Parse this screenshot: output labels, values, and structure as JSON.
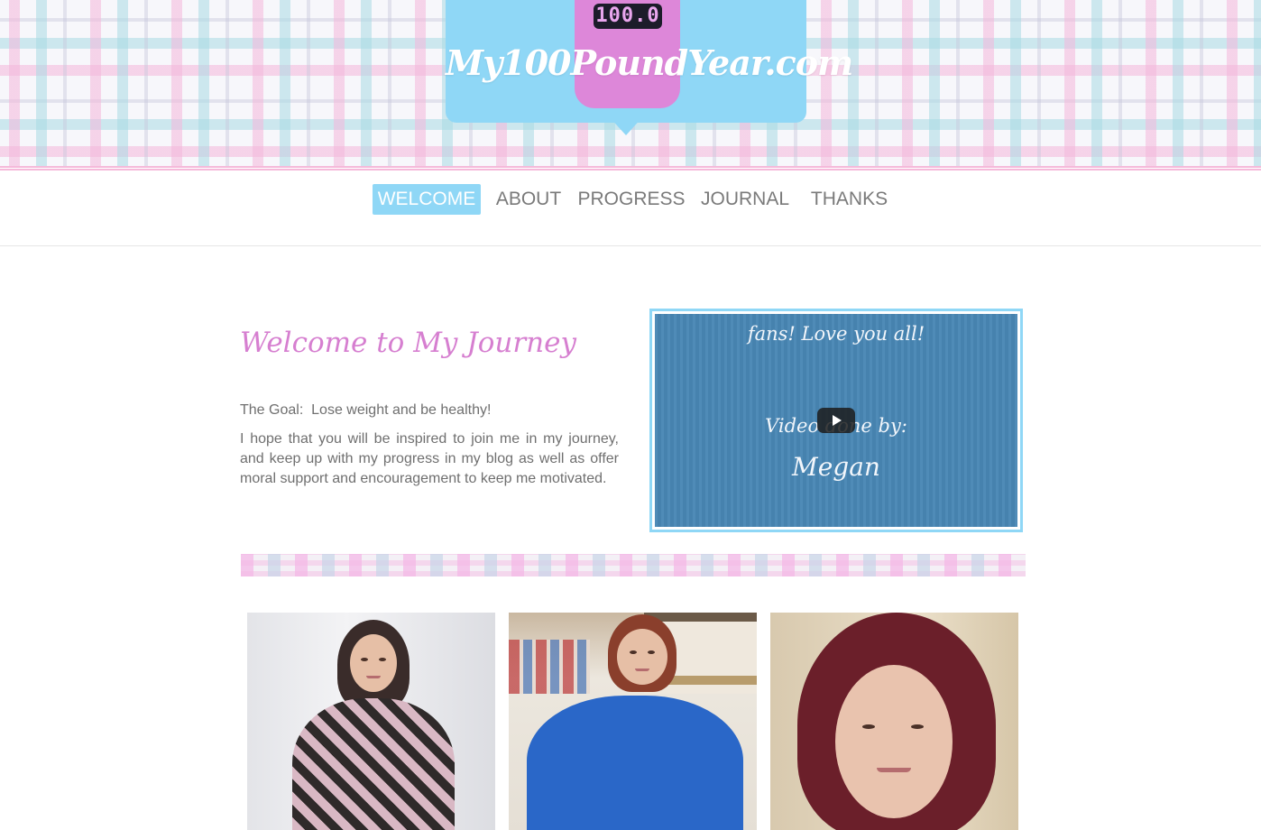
{
  "site": {
    "logo_text": "My100PoundYear.com",
    "scale_display": "100.0"
  },
  "nav": {
    "items": [
      {
        "label": "WELCOME",
        "active": true
      },
      {
        "label": "ABOUT",
        "active": false
      },
      {
        "label": "PROGRESS",
        "active": false
      },
      {
        "label": "JOURNAL",
        "active": false
      },
      {
        "label": "THANKS",
        "active": false
      }
    ]
  },
  "welcome": {
    "title": "Welcome to My Journey",
    "goal": "The Goal:  Lose weight and be healthy!",
    "intro": "I hope that you will be inspired to join me in my journey, and keep up with my progress in my blog as well as offer moral support and encouragement to keep me motivated."
  },
  "video": {
    "line_1": "fans! Love you all!",
    "line_2": "Video done by:",
    "line_3": "Megan",
    "play_icon": "play-icon"
  },
  "colors": {
    "accent_blue": "#8fd7f6",
    "accent_pink": "#d67fd0",
    "text_gray": "#6f6f6f",
    "nav_gray": "#7a7a7a"
  },
  "photos": [
    {
      "label": "photo-before"
    },
    {
      "label": "photo-progress"
    },
    {
      "label": "photo-portrait"
    }
  ]
}
